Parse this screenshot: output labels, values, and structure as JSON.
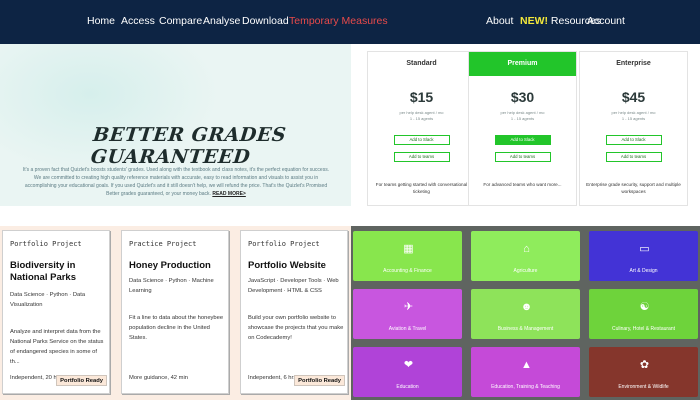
{
  "nav": {
    "left": [
      "Home",
      "Access",
      "Compare",
      "Analyse",
      "Download",
      "Temporary Measures"
    ],
    "about": "About",
    "new_tag": "NEW!",
    "resources": "Resources",
    "account": "Account",
    "colors": {
      "bar": "#0d2444",
      "highlight": "#e84a4a",
      "new": "#f3e83b"
    }
  },
  "hero": {
    "heading": "BETTER GRADES GUARANTEED",
    "body": "It's a proven fact that Quizlet's boosts students' grades. Used along with the textbook and class notes, it's the perfect equation for success. We are committed to creating high quality reference materials with accurate, easy to read information and visuals to assist you in accomplishing your educational goals. If you used Quizlet's and it still doesn't help, we will refund the price. That's the Quizlet's Promised Better grades guaranteed, or your money back.",
    "read_more": "READ MORE>"
  },
  "pricing": {
    "accent": "#22c52a",
    "plans": [
      {
        "name": "Standard",
        "price": "$15",
        "sub1": "per help desk agent / mo",
        "sub2": "1 - 15 agents",
        "btn1": "Add to Slack",
        "btn2": "Add to teams",
        "desc": "For teams getting started with conversational ticketing"
      },
      {
        "name": "Premium",
        "price": "$30",
        "sub1": "per help desk agent / mo",
        "sub2": "1 - 15 agents",
        "btn1": "Add to Slack",
        "btn2": "Add to teams",
        "desc": "For advanced teams who want more..."
      },
      {
        "name": "Enterprise",
        "price": "$45",
        "sub1": "per help desk agent / mo",
        "sub2": "1 - 15 agents",
        "btn1": "Add to Slack",
        "btn2": "Add to teams",
        "desc": "Enterprise grade security, support and multiple workspaces"
      }
    ]
  },
  "projects": [
    {
      "kind": "Portfolio Project",
      "title": "Biodiversity in National Parks",
      "tags": "Data Science · Python · Data Visualization",
      "body": "Analyze and interpret data from the National Parks Service on the status of endangered species in some of th...",
      "meta": "Independent, 20 hrs",
      "badge": "Portfolio Ready"
    },
    {
      "kind": "Practice Project",
      "title": "Honey Production",
      "tags": "Data Science · Python · Machine Learning",
      "body": "Fit a line to data about the honeybee population decline in the United States.",
      "meta": "More guidance, 42 min",
      "badge": ""
    },
    {
      "kind": "Portfolio Project",
      "title": "Portfolio Website",
      "tags": "JavaScript · Developer Tools · Web Development · HTML & CSS",
      "body": "Build your own portfolio website to showcase the projects that you make on Codecademy!",
      "meta": "Independent, 6 hrs",
      "badge": "Portfolio Ready"
    }
  ],
  "categories": [
    {
      "label": "Accounting & Finance",
      "icon": "calculator-icon",
      "color": "#88e64d"
    },
    {
      "label": "Agriculture",
      "icon": "farm-icon",
      "color": "#8fec5c"
    },
    {
      "label": "Art & Design",
      "icon": "monitor-icon",
      "color": "#4333d6"
    },
    {
      "label": "Aviation & Travel",
      "icon": "airplane-icon",
      "color": "#c856df"
    },
    {
      "label": "Business & Management",
      "icon": "people-icon",
      "color": "#8ee35a"
    },
    {
      "label": "Culinary, Hotel & Restaurant",
      "icon": "chef-hat-icon",
      "color": "#6ed33b"
    },
    {
      "label": "Education",
      "icon": "hand-heart-icon",
      "color": "#b043d8"
    },
    {
      "label": "Education, Training & Teaching",
      "icon": "graduation-cap-icon",
      "color": "#c54ad8"
    },
    {
      "label": "Environment & Wildlife",
      "icon": "leaf-icon",
      "color": "#85362c"
    }
  ]
}
